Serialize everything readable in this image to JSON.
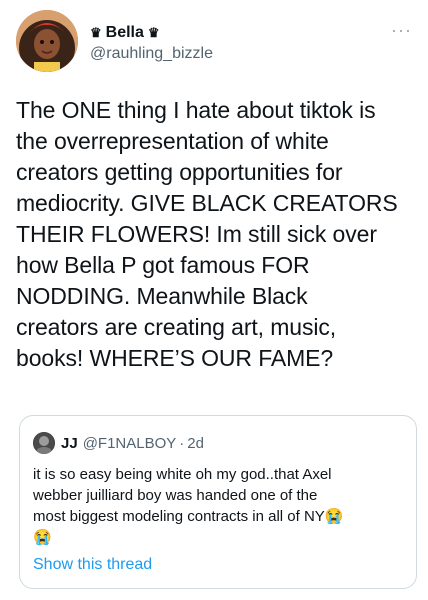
{
  "author": {
    "crown_left": "♛",
    "name": "Bella",
    "crown_right": "♛",
    "handle": "@rauhling_bizzle"
  },
  "more_icon": "···",
  "tweet": {
    "text": "The ONE thing I hate about tiktok is\nthe overrepresentation of white\ncreators getting opportunities for\nmediocrity. GIVE BLACK CREATORS\nTHEIR FLOWERS! Im still sick over\nhow Bella P got famous FOR\nNODDING. Meanwhile Black\ncreators are creating art, music,\nbooks! WHERE’S OUR FAME?"
  },
  "quote": {
    "name": "JJ",
    "handle": "@F1NALBOY",
    "separator": "·",
    "time": "2d",
    "text": "it is so easy being white oh my god..that Axel\nwebber juilliard boy was handed one of the\nmost biggest modeling contracts in all of NY",
    "emoji1": "😭",
    "emoji2": "😭",
    "show_thread": "Show this thread"
  },
  "colors": {
    "text": "#0f1419",
    "secondary": "#536471",
    "link": "#1d9bf0",
    "border": "#cfd9de"
  }
}
